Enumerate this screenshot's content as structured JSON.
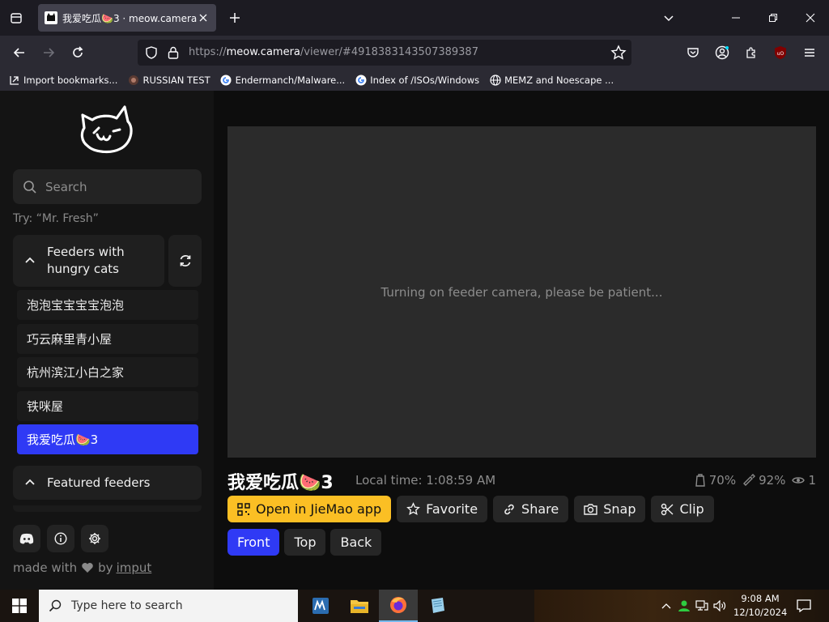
{
  "browser": {
    "tab_title": "我爱吃瓜🍉3 · meow.camera",
    "url_prefix": "https://",
    "url_host": "meow.camera",
    "url_rest": "/viewer/#4918383143507389387",
    "bookmarks": [
      {
        "label": "Import bookmarks...",
        "icon": "import-icon"
      },
      {
        "label": "RUSSIAN TEST",
        "icon": "site-icon"
      },
      {
        "label": "Endermanch/Malware...",
        "icon": "google-icon"
      },
      {
        "label": "Index of /ISOs/Windows",
        "icon": "google-icon"
      },
      {
        "label": "MEMZ and Noescape ...",
        "icon": "globe-icon"
      }
    ]
  },
  "sidebar": {
    "search_placeholder": "Search",
    "try_hint": "Try: “Mr. Fresh”",
    "section_hungry": "Feeders with hungry cats",
    "feeders": [
      {
        "label": "泡泡宝宝宝宝泡泡",
        "active": false
      },
      {
        "label": "巧云麻里青小屋",
        "active": false
      },
      {
        "label": "杭州滨江小白之家",
        "active": false
      },
      {
        "label": "铁咪屋",
        "active": false
      },
      {
        "label": "我爱吃瓜🍉3",
        "active": true
      }
    ],
    "section_featured": "Featured feeders",
    "made_with": "made with",
    "by": "by",
    "author": "imput"
  },
  "viewer": {
    "status_message": "Turning on feeder camera, please be patient...",
    "feeder_name": "我爱吃瓜🍉3",
    "local_time": "Local time: 1:08:59 AM",
    "food_level": "70%",
    "water_level": "92%",
    "viewers": "1",
    "actions": {
      "app": "Open in JieMao app",
      "favorite": "Favorite",
      "share": "Share",
      "snap": "Snap",
      "clip": "Clip"
    },
    "views": {
      "front": "Front",
      "top": "Top",
      "back": "Back"
    }
  },
  "taskbar": {
    "search_placeholder": "Type here to search",
    "time": "9:08 AM",
    "date": "12/10/2024"
  },
  "colors": {
    "accent_blue": "#2f3af5",
    "app_yellow": "#fbbf24"
  }
}
